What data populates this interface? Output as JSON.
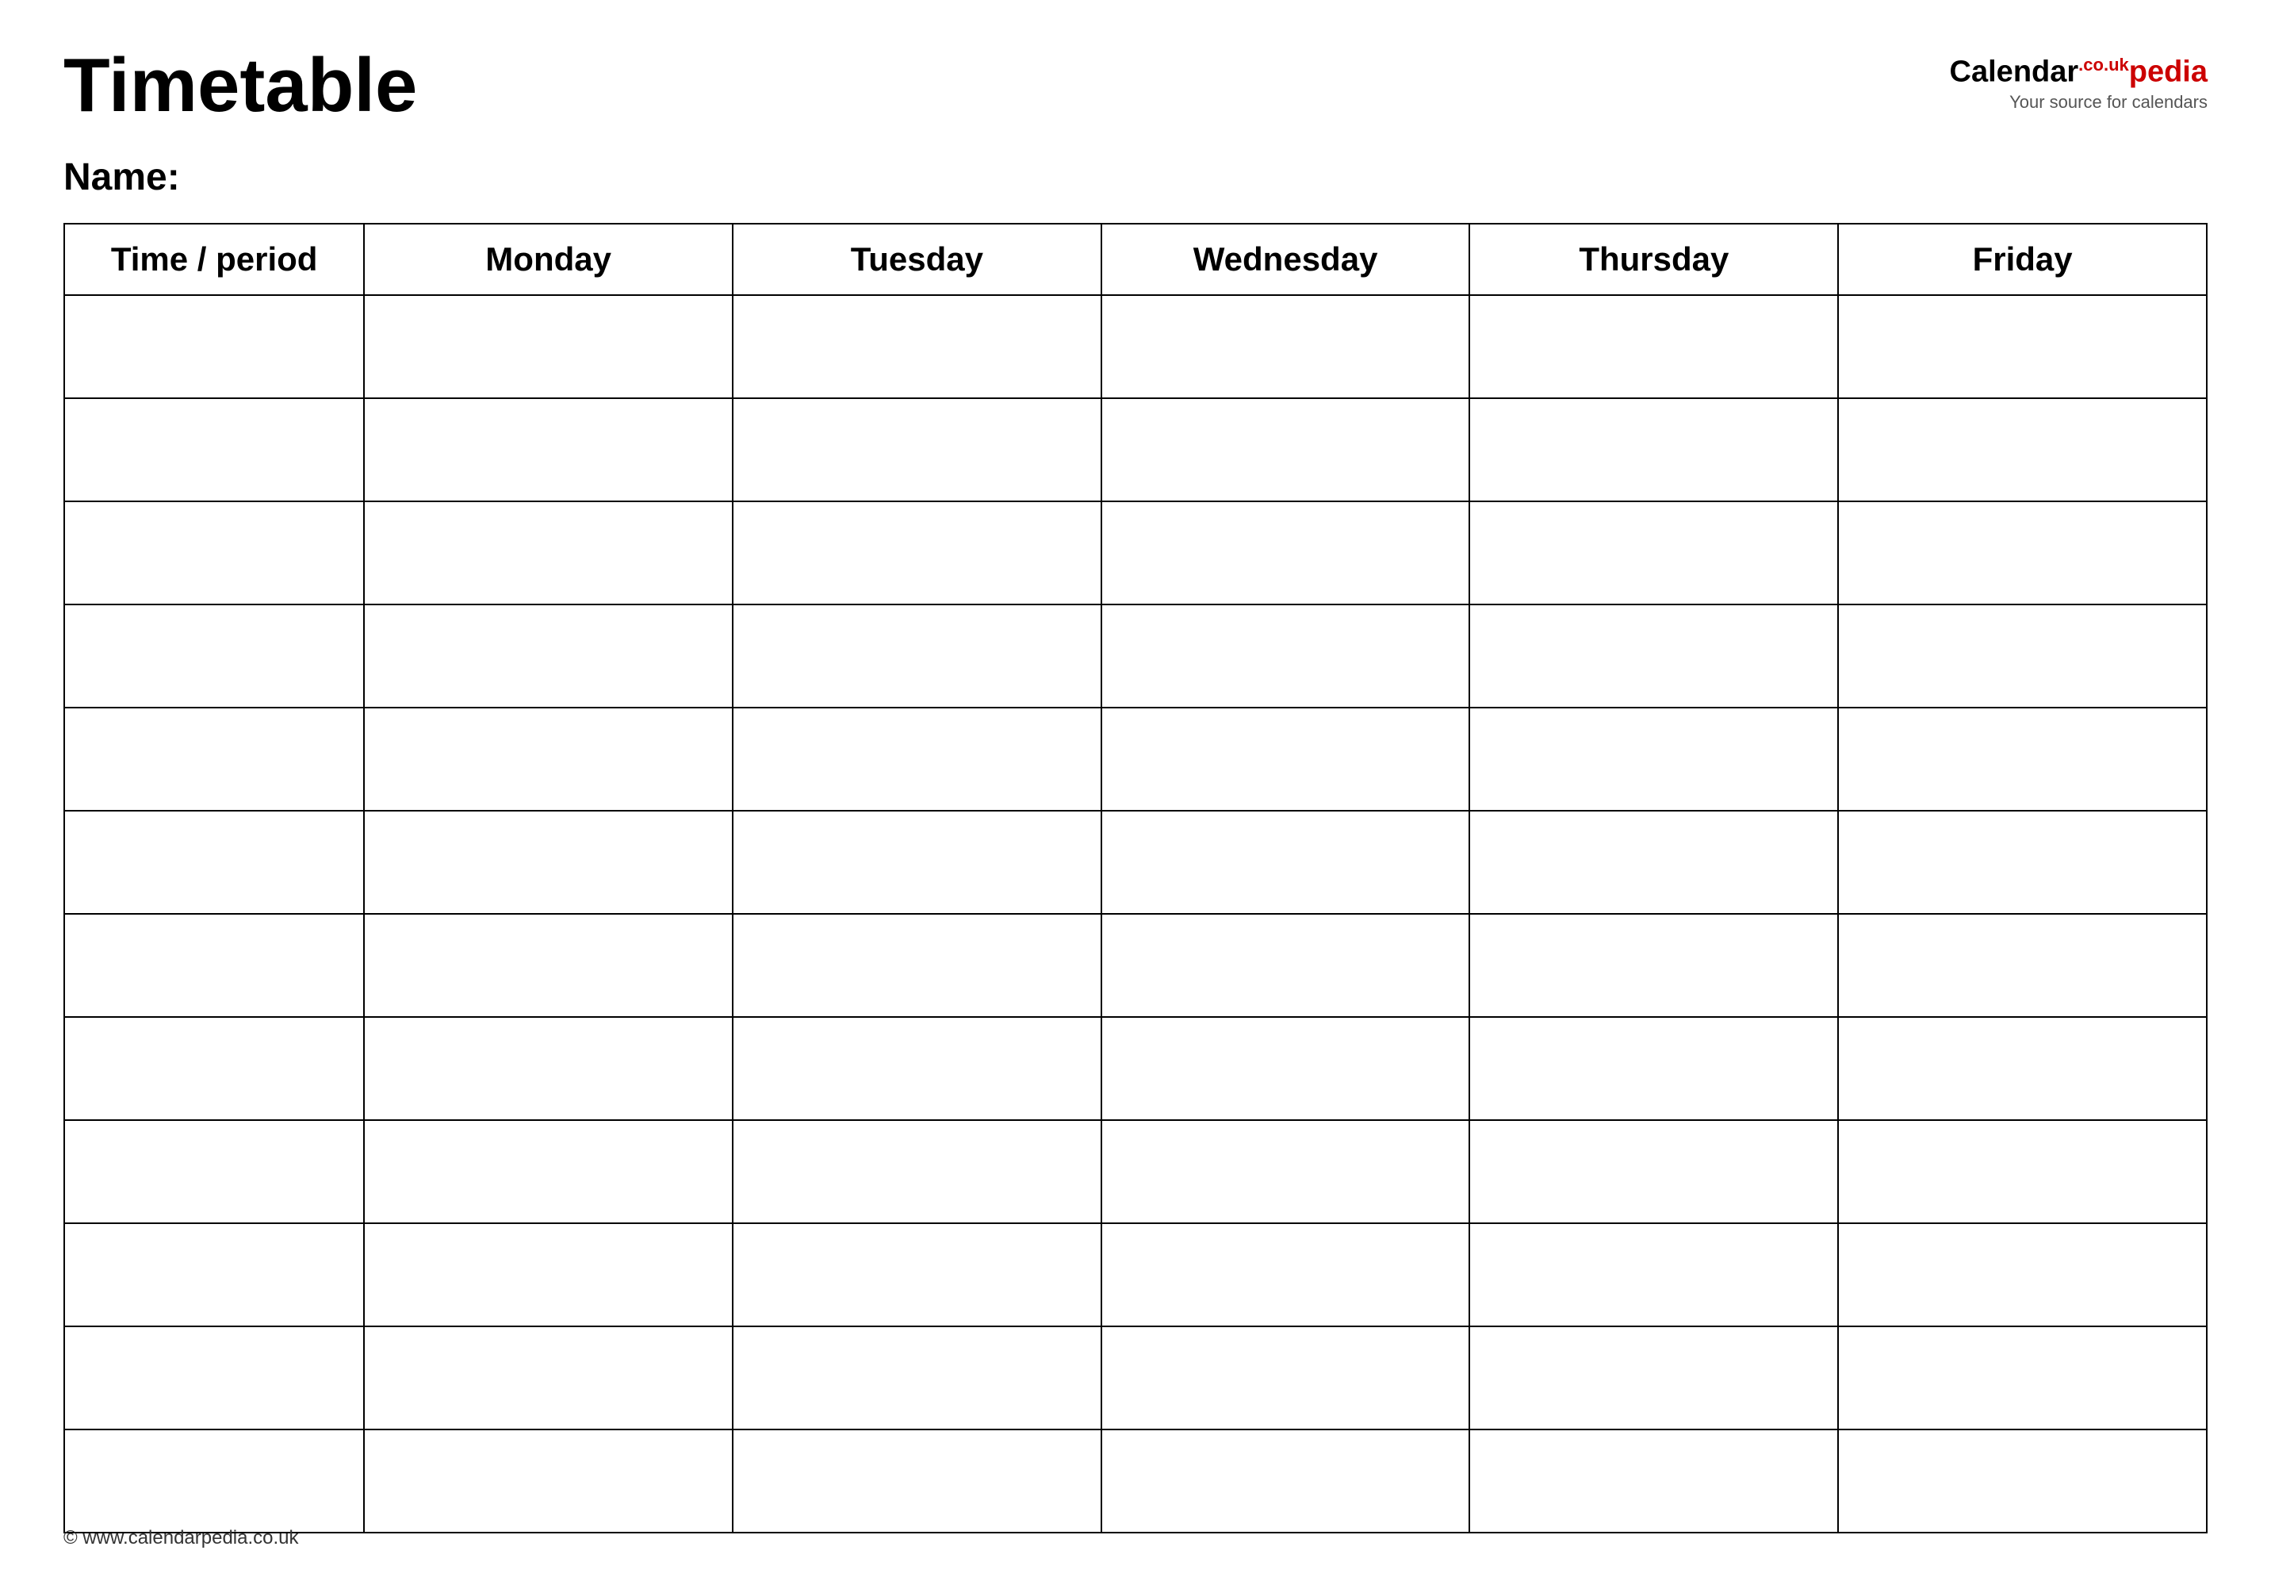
{
  "header": {
    "title": "Timetable",
    "logo": {
      "calendar_text": "Calendar",
      "pedia_text": "pedia",
      "couk": ".co.uk",
      "subtitle": "Your source for calendars"
    }
  },
  "name_section": {
    "label": "Name:"
  },
  "table": {
    "columns": [
      "Time / period",
      "Monday",
      "Tuesday",
      "Wednesday",
      "Thursday",
      "Friday"
    ],
    "row_count": 12
  },
  "footer": {
    "url": "© www.calendarpedia.co.uk"
  }
}
